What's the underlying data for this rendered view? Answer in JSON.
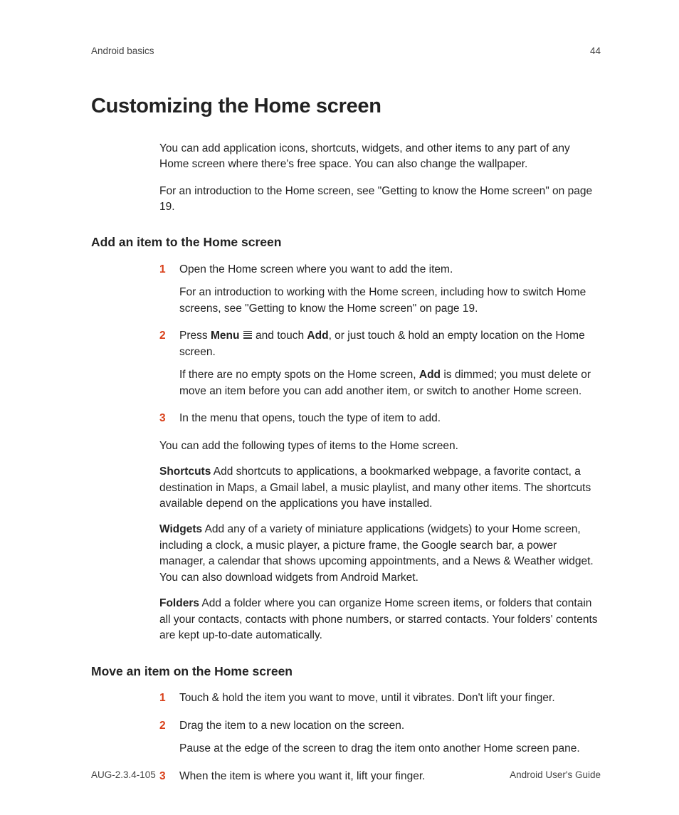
{
  "header": {
    "section": "Android basics",
    "page": "44"
  },
  "title": "Customizing the Home screen",
  "intro": {
    "p1": "You can add application icons, shortcuts, widgets, and other items to any part of any Home screen where there's free space. You can also change the wallpaper.",
    "p2": "For an introduction to the Home screen, see \"Getting to know the Home screen\" on page 19."
  },
  "section1": {
    "heading": "Add an item to the Home screen",
    "steps": {
      "s1_num": "1",
      "s1_a": "Open the Home screen where you want to add the item.",
      "s1_b": "For an introduction to working with the Home screen, including how to switch Home screens, see \"Getting to know the Home screen\" on page 19.",
      "s2_num": "2",
      "s2_a_pre": "Press ",
      "s2_a_menu": "Menu",
      "s2_a_mid": " and touch ",
      "s2_a_add": "Add",
      "s2_a_post": ", or just touch & hold an empty location on the Home screen.",
      "s2_b_pre": "If there are no empty spots on the Home screen, ",
      "s2_b_add": "Add",
      "s2_b_post": " is dimmed; you must delete or move an item before you can add another item, or switch to another Home screen.",
      "s3_num": "3",
      "s3_a": "In the menu that opens, touch the type of item to add."
    },
    "after": "You can add the following types of items to the Home screen.",
    "shortcuts_label": "Shortcuts",
    "shortcuts_body": "   Add shortcuts to applications, a bookmarked webpage, a favorite contact, a destination in Maps, a Gmail label, a music playlist, and many other items. The shortcuts available depend on the applications you have installed.",
    "widgets_label": "Widgets",
    "widgets_body": "   Add any of a variety of miniature applications (widgets) to your Home screen, including a clock, a music player, a picture frame, the Google search bar, a power manager, a calendar that shows upcoming appointments, and a News & Weather widget. You can also download widgets from Android Market.",
    "folders_label": "Folders",
    "folders_body": "   Add a folder where you can organize Home screen items, or folders that contain all your contacts, contacts with phone numbers, or starred contacts. Your folders' contents are kept up-to-date automatically."
  },
  "section2": {
    "heading": "Move an item on the Home screen",
    "s1_num": "1",
    "s1": "Touch & hold the item you want to move, until it vibrates. Don't lift your finger.",
    "s2_num": "2",
    "s2_a": "Drag the item to a new location on the screen.",
    "s2_b": "Pause at the edge of the screen to drag the item onto another Home screen pane.",
    "s3_num": "3",
    "s3": "When the item is where you want it, lift your finger."
  },
  "footer": {
    "left": "AUG-2.3.4-105",
    "right": "Android User's Guide"
  }
}
